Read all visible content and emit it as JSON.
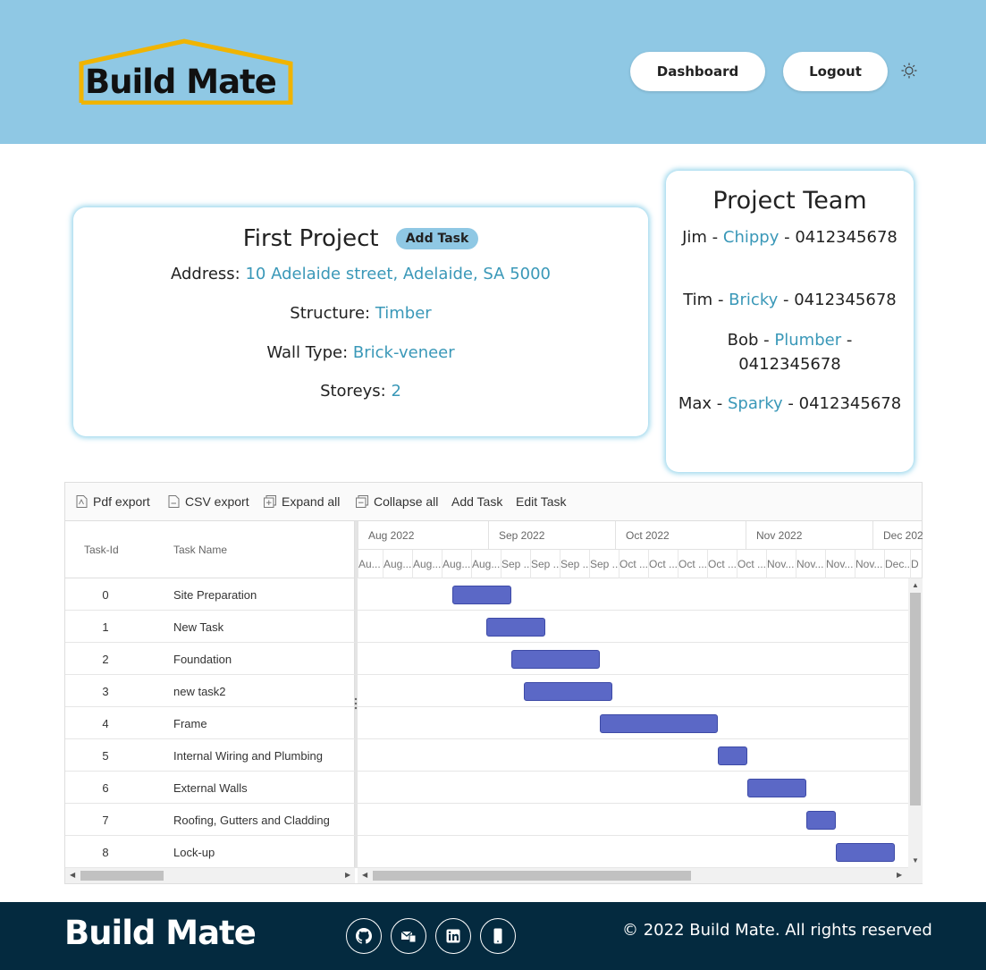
{
  "header": {
    "logo_text": "Build Mate",
    "nav": {
      "dashboard": "Dashboard",
      "logout": "Logout"
    },
    "theme_icon": "sun-icon"
  },
  "project": {
    "title": "First Project",
    "add_task_label": "Add Task",
    "address_label": "Address:",
    "address": "10 Adelaide street, Adelaide, SA 5000",
    "structure_label": "Structure:",
    "structure": "Timber",
    "wall_label": "Wall Type:",
    "wall": "Brick-veneer",
    "storeys_label": "Storeys:",
    "storeys": "2"
  },
  "team": {
    "title": "Project Team",
    "members": [
      {
        "name": "Jim",
        "role": "Chippy",
        "phone": "0412345678"
      },
      {
        "name": "Tim",
        "role": "Bricky",
        "phone": "0412345678"
      },
      {
        "name": "Bob",
        "role": "Plumber",
        "phone": "0412345678"
      },
      {
        "name": "Max",
        "role": "Sparky",
        "phone": "0412345678"
      }
    ]
  },
  "gantt": {
    "toolbar": [
      {
        "label": "Pdf export",
        "icon": "pdf-icon"
      },
      {
        "label": "CSV export",
        "icon": "csv-icon"
      },
      {
        "label": "Expand all",
        "icon": "expand-icon"
      },
      {
        "label": "Collapse all",
        "icon": "collapse-icon"
      },
      {
        "label": "Add Task",
        "icon": ""
      },
      {
        "label": "Edit Task",
        "icon": ""
      }
    ],
    "columns": {
      "id": "Task-Id",
      "name": "Task Name"
    },
    "months": [
      "Aug 2022",
      "Sep 2022",
      "Oct 2022",
      "Nov 2022",
      "Dec 2022"
    ],
    "weeks": [
      "Au...",
      "Aug...",
      "Aug...",
      "Aug...",
      "Aug...",
      "Sep ...",
      "Sep ...",
      "Sep ...",
      "Sep ...",
      "Oct ...",
      "Oct ...",
      "Oct ...",
      "Oct ...",
      "Oct ...",
      "Nov...",
      "Nov...",
      "Nov...",
      "Nov...",
      "Dec...",
      "D"
    ],
    "tasks": [
      {
        "id": "0",
        "name": "Site Preparation"
      },
      {
        "id": "1",
        "name": "New Task"
      },
      {
        "id": "2",
        "name": "Foundation"
      },
      {
        "id": "3",
        "name": "new task2"
      },
      {
        "id": "4",
        "name": "Frame"
      },
      {
        "id": "5",
        "name": "Internal Wiring and Plumbing"
      },
      {
        "id": "6",
        "name": "External Walls"
      },
      {
        "id": "7",
        "name": "Roofing, Gutters and Cladding"
      },
      {
        "id": "8",
        "name": "Lock-up"
      }
    ],
    "bar_color": "#5b68c6"
  },
  "footer": {
    "brand": "Build Mate",
    "icons": [
      "github-icon",
      "mail-icon",
      "linkedin-icon",
      "mobile-icon"
    ],
    "copyright": "© 2022 Build Mate. All rights reserved"
  }
}
